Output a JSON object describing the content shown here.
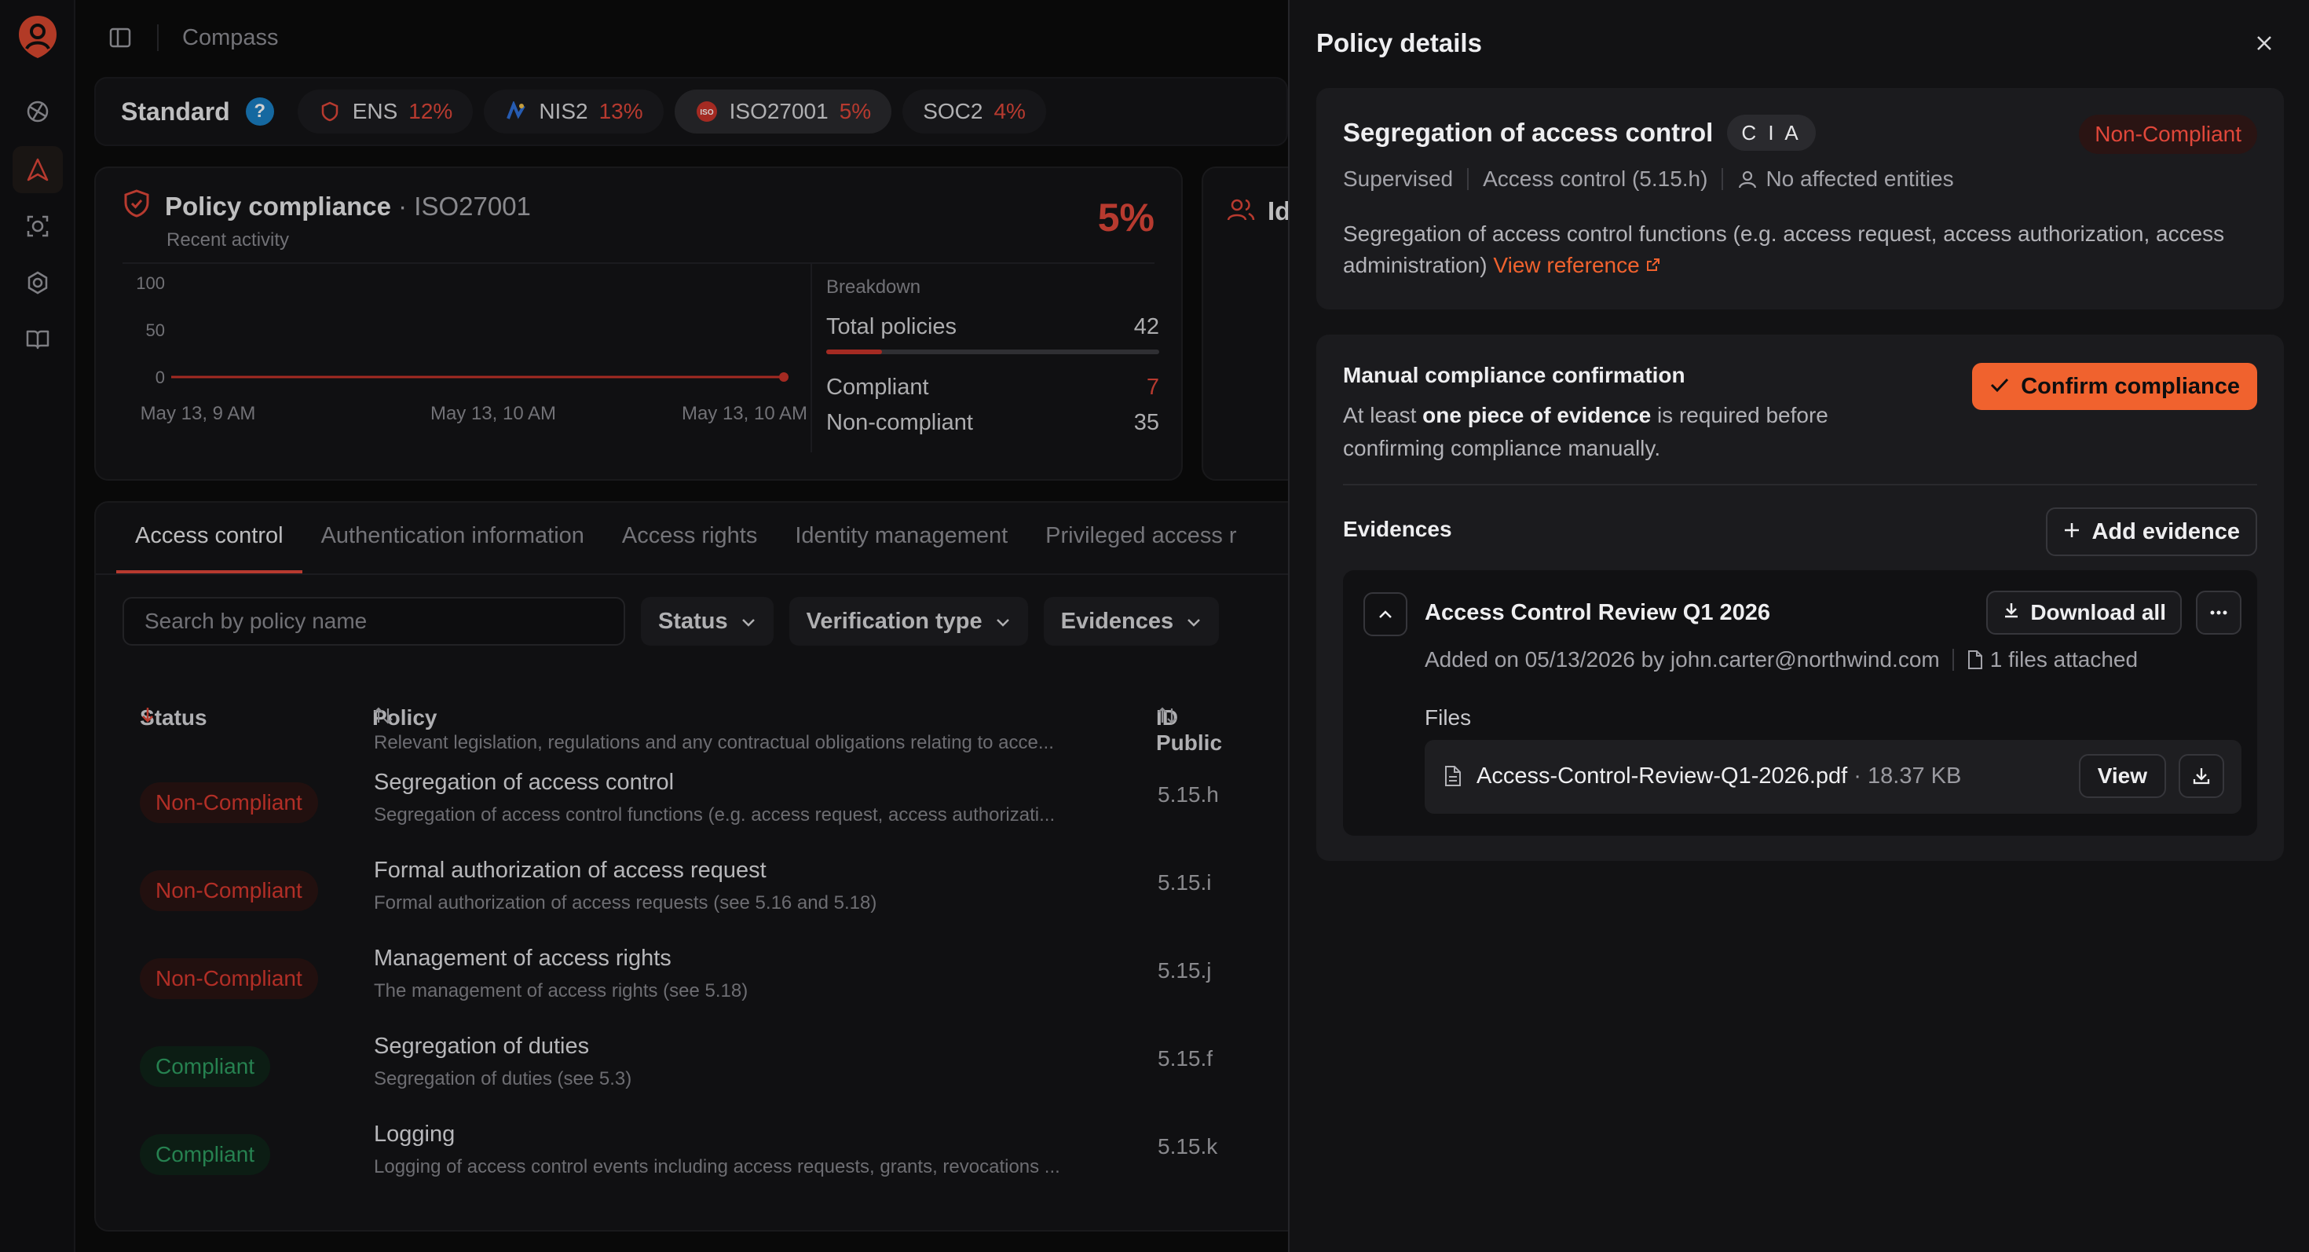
{
  "topbar": {
    "breadcrumb": "Compass"
  },
  "standards": {
    "label": "Standard",
    "help": "?",
    "items": [
      {
        "name": "ENS",
        "pct": "12%"
      },
      {
        "name": "NIS2",
        "pct": "13%"
      },
      {
        "name": "ISO27001",
        "pct": "5%"
      },
      {
        "name": "SOC2",
        "pct": "4%"
      }
    ]
  },
  "compliance": {
    "title": "Policy compliance",
    "standard": "· ISO27001",
    "subtitle": "Recent activity",
    "percent": "5%",
    "second_card_title": "Id"
  },
  "chart_data": {
    "type": "line",
    "y_ticks": [
      "100",
      "50",
      "0"
    ],
    "x_ticks": [
      "May 13, 9 AM",
      "May 13, 10 AM",
      "May 13, 10 AM"
    ],
    "ylim": [
      0,
      100
    ],
    "series": [
      {
        "values": [
          5,
          5,
          5,
          5,
          5,
          5,
          5,
          5
        ]
      }
    ],
    "color": "#c8342a"
  },
  "breakdown": {
    "label": "Breakdown",
    "total_label": "Total policies",
    "total": "42",
    "compliant_fraction": 0.167,
    "compliant_label": "Compliant",
    "compliant": "7",
    "noncompliant_label": "Non-compliant",
    "noncompliant": "35"
  },
  "tabs": [
    "Access control",
    "Authentication information",
    "Access rights",
    "Identity management",
    "Privileged access r"
  ],
  "filters": {
    "search_placeholder": "Search by policy name",
    "status": "Status",
    "verification": "Verification type",
    "evidences": "Evidences"
  },
  "table": {
    "headers": {
      "status": "Status",
      "policy": "Policy",
      "id": "ID Public"
    },
    "partial_row": "Relevant legislation, regulations and any contractual obligations relating to acce...",
    "rows": [
      {
        "status": "Non-Compliant",
        "kind": "nc",
        "name": "Segregation of access control",
        "desc": "Segregation of access control functions (e.g. access request, access authorizati...",
        "id": "5.15.h"
      },
      {
        "status": "Non-Compliant",
        "kind": "nc",
        "name": "Formal authorization of access request",
        "desc": "Formal authorization of access requests (see 5.16 and 5.18)",
        "id": "5.15.i"
      },
      {
        "status": "Non-Compliant",
        "kind": "nc",
        "name": "Management of access rights",
        "desc": "The management of access rights (see 5.18)",
        "id": "5.15.j"
      },
      {
        "status": "Compliant",
        "kind": "c",
        "name": "Segregation of duties",
        "desc": "Segregation of duties (see 5.3)",
        "id": "5.15.f"
      },
      {
        "status": "Compliant",
        "kind": "c",
        "name": "Logging",
        "desc": "Logging of access control events including access requests, grants, revocations ...",
        "id": "5.15.k"
      }
    ]
  },
  "panel": {
    "title": "Policy details",
    "policy": {
      "name": "Segregation of access control",
      "cia": "C I A",
      "status": "Non-Compliant",
      "supervision": "Supervised",
      "category": "Access control (5.15.h)",
      "entities": "No affected entities",
      "description": "Segregation of access control functions (e.g. access request, access authorization, access administration)",
      "reference_link": "View reference"
    },
    "manual": {
      "title": "Manual compliance confirmation",
      "text_before": "At least ",
      "text_bold": "one piece of evidence",
      "text_after": " is required before confirming compliance manually.",
      "confirm": "Confirm compliance"
    },
    "evidences": {
      "title": "Evidences",
      "add": "Add evidence",
      "item": {
        "name": "Access Control Review Q1 2026",
        "download_all": "Download all",
        "added": "Added on 05/13/2026 by john.carter@northwind.com",
        "files_count": "1 files attached",
        "files_label": "Files",
        "file_name": "Access-Control-Review-Q1-2026.pdf",
        "file_sep": " · ",
        "file_size": "18.37 KB",
        "view": "View"
      }
    }
  },
  "colors": {
    "accent": "#f0622e",
    "danger": "#e0473a",
    "success": "#2f9e62"
  }
}
